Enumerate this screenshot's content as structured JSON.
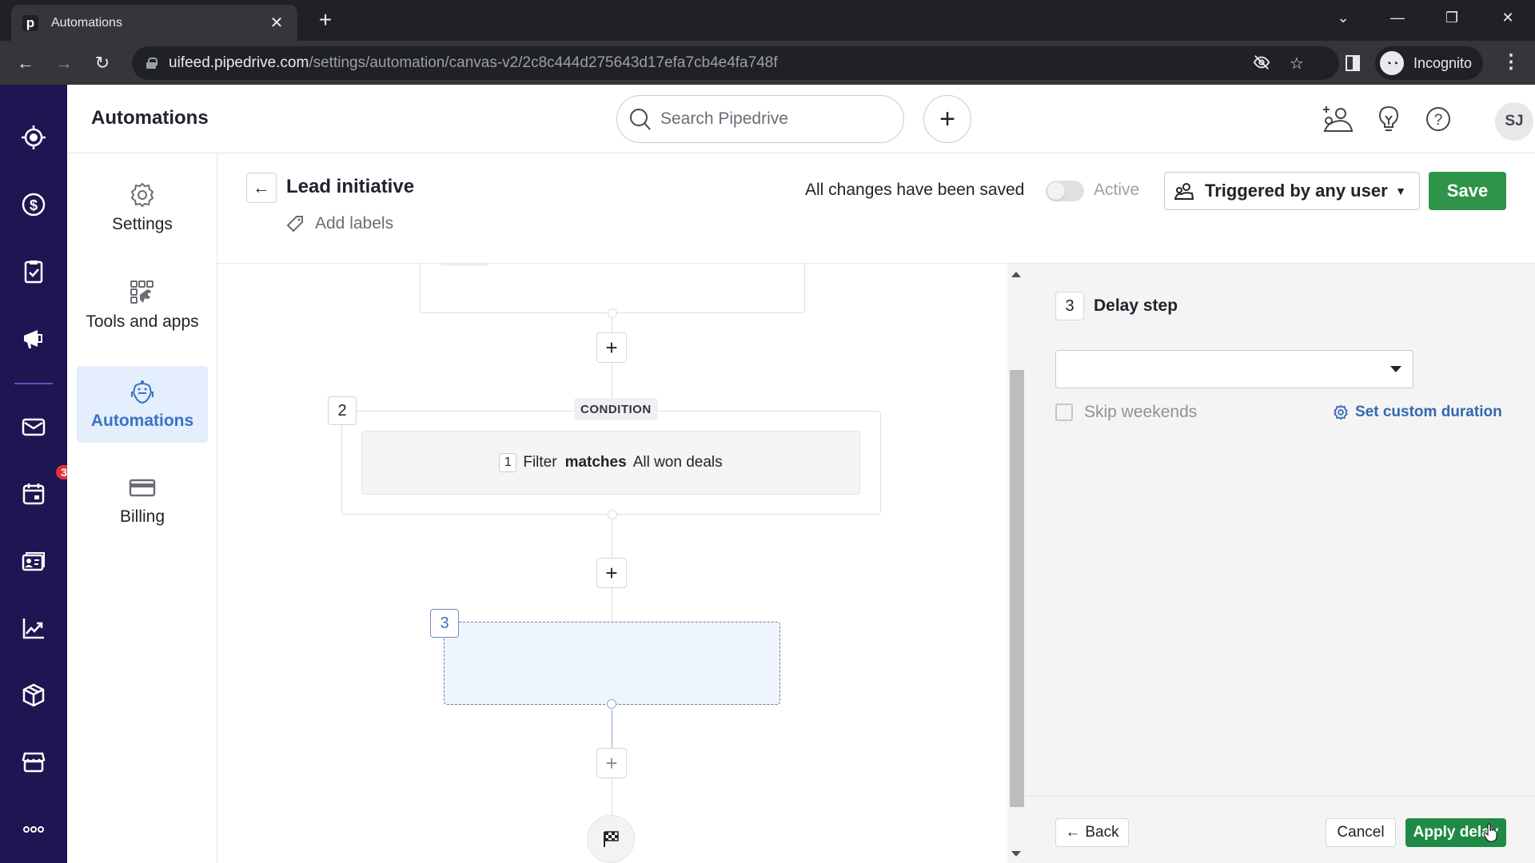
{
  "browser": {
    "tab_title": "Automations",
    "favicon_letter": "p",
    "url_host": "uifeed.pipedrive.com",
    "url_path": "/settings/automation/canvas-v2/2c8c444d275643d17efa7cb4e4fa748f",
    "incognito_label": "Incognito"
  },
  "header": {
    "title": "Automations",
    "search_placeholder": "Search Pipedrive",
    "avatar_initials": "SJ"
  },
  "rail": {
    "items": [
      "leads",
      "deals",
      "activities",
      "campaigns",
      "mail",
      "calendar",
      "contacts",
      "insights",
      "products",
      "marketplace",
      "more"
    ],
    "calendar_badge": "3"
  },
  "settings_nav": {
    "items": [
      {
        "label": "Settings",
        "icon": "gear-icon",
        "active": false
      },
      {
        "label": "Tools and apps",
        "icon": "tools-icon",
        "active": false
      },
      {
        "label": "Automations",
        "icon": "robot-icon",
        "active": true
      },
      {
        "label": "Billing",
        "icon": "credit-card-icon",
        "active": false
      }
    ]
  },
  "workflow": {
    "title": "Lead initiative",
    "add_labels": "Add labels",
    "save_status": "All changes have been saved",
    "active_label": "Active",
    "active": false,
    "trigger_select": "Triggered by any user",
    "save_label": "Save"
  },
  "canvas": {
    "step2": {
      "number": "2",
      "tag": "CONDITION",
      "filter_index": "1",
      "filter_word": "Filter",
      "operator": "matches",
      "value": "All won deals"
    },
    "step3": {
      "number": "3"
    }
  },
  "panel": {
    "step_number": "3",
    "title": "Delay step",
    "delay_value": "",
    "skip_weekends_label": "Skip weekends",
    "skip_weekends_checked": false,
    "custom_duration_label": "Set custom duration",
    "back_label": "Back",
    "cancel_label": "Cancel",
    "apply_label": "Apply delay"
  },
  "colors": {
    "rail_bg": "#1e1652",
    "primary_green": "#2f9449",
    "link_blue": "#3367b3",
    "active_nav_bg": "#e4eefc"
  }
}
